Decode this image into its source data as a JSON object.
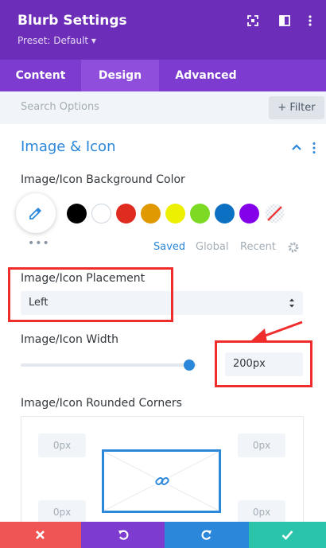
{
  "header": {
    "title": "Blurb Settings",
    "preset": "Preset: Default ▾"
  },
  "tabs": [
    "Content",
    "Design",
    "Advanced"
  ],
  "search": {
    "placeholder": "Search Options",
    "filter_label": "+ Filter"
  },
  "section": {
    "title": "Image & Icon"
  },
  "background_color": {
    "label": "Image/Icon Background Color",
    "swatches": [
      "#000000",
      "#ffffff",
      "#e02b20",
      "#e09900",
      "#edf000",
      "#7cda24",
      "#0c71c3",
      "#8300e9"
    ],
    "tabs": [
      "Saved",
      "Global",
      "Recent"
    ]
  },
  "placement": {
    "label": "Image/Icon Placement",
    "value": "Left"
  },
  "width": {
    "label": "Image/Icon Width",
    "value": "200px",
    "slider_fraction": 0.96
  },
  "rounded_corners": {
    "label": "Image/Icon Rounded Corners",
    "values": [
      "0px",
      "0px",
      "0px",
      "0px"
    ]
  },
  "colors": {
    "header": "#6c2eb9",
    "tabs": "#7d3bcf",
    "accent": "#2b87da",
    "annotation": "#f02d2d",
    "cancel": "#ef5555",
    "undo": "#7d3bcf",
    "redo": "#2b87da",
    "save": "#29c4a9"
  }
}
